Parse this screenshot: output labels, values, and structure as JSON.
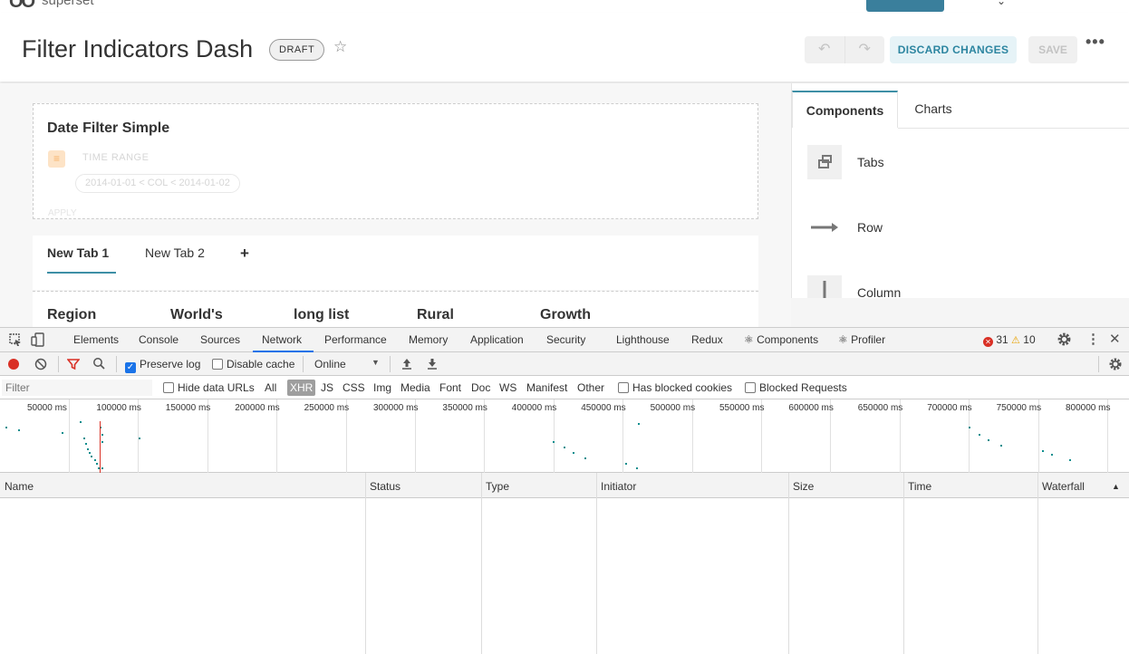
{
  "header": {
    "logo_mark": "OO",
    "logo_word": "superset",
    "title": "Filter Indicators Dash",
    "status_badge": "DRAFT",
    "undo_icon": "undo-icon",
    "redo_icon": "redo-icon",
    "discard_label": "DISCARD CHANGES",
    "save_label": "SAVE",
    "more_label": "•••"
  },
  "filter_chart": {
    "title": "Date Filter Simple",
    "field_label": "TIME RANGE",
    "time_range_value": "2014-01-01 < COL < 2014-01-02",
    "apply_label": "APPLY"
  },
  "dashboard_tabs": {
    "tabs": [
      "New Tab 1",
      "New Tab 2"
    ],
    "add_label": "+"
  },
  "chart_columns": [
    "Region",
    "World's",
    "long list",
    "Rural",
    "Growth"
  ],
  "builder": {
    "tabs": [
      "Components",
      "Charts"
    ],
    "components": [
      "Tabs",
      "Row",
      "Column"
    ]
  },
  "devtools": {
    "tabs": [
      "Elements",
      "Console",
      "Sources",
      "Network",
      "Performance",
      "Memory",
      "Application",
      "Security",
      "Lighthouse",
      "Redux",
      "⚛ Components",
      "⚛ Profiler"
    ],
    "active_tab": "Network",
    "error_count": "31",
    "warning_count": "10",
    "toolbar": {
      "preserve_log": "Preserve log",
      "preserve_log_checked": true,
      "disable_cache": "Disable cache",
      "disable_cache_checked": false,
      "throttling": "Online"
    },
    "filter": {
      "placeholder": "Filter",
      "hide_data_urls": "Hide data URLs",
      "types": [
        "All",
        "XHR",
        "JS",
        "CSS",
        "Img",
        "Media",
        "Font",
        "Doc",
        "WS",
        "Manifest",
        "Other"
      ],
      "active_type": "XHR",
      "has_blocked_cookies": "Has blocked cookies",
      "blocked_requests": "Blocked Requests"
    },
    "timeline_labels": [
      "50000 ms",
      "100000 ms",
      "150000 ms",
      "200000 ms",
      "250000 ms",
      "300000 ms",
      "350000 ms",
      "400000 ms",
      "450000 ms",
      "500000 ms",
      "550000 ms",
      "600000 ms",
      "650000 ms",
      "700000 ms",
      "750000 ms",
      "800000 ms"
    ],
    "columns": [
      "Name",
      "Status",
      "Type",
      "Initiator",
      "Size",
      "Time",
      "Waterfall"
    ],
    "sort_indicator": "▲"
  }
}
